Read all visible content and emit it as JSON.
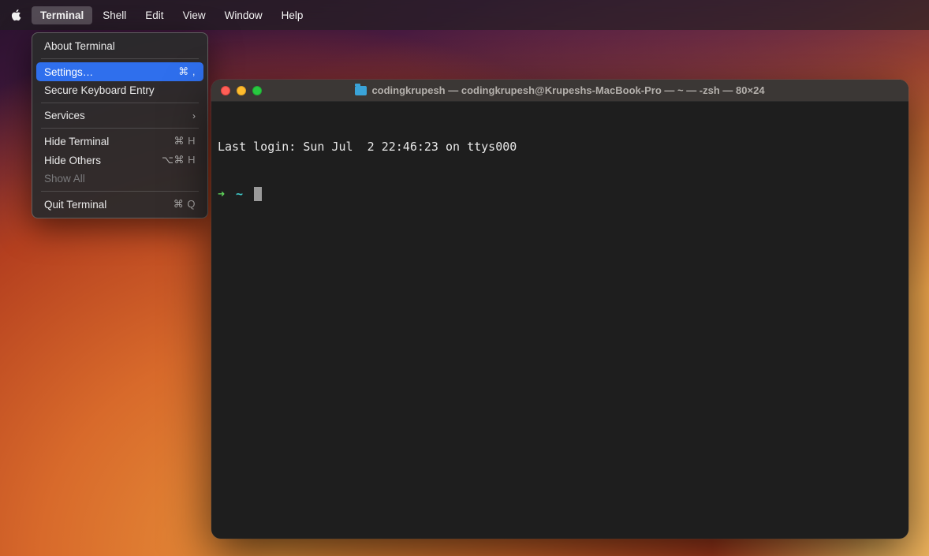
{
  "menubar": {
    "items": [
      "Terminal",
      "Shell",
      "Edit",
      "View",
      "Window",
      "Help"
    ],
    "active": "Terminal"
  },
  "dropdown": {
    "about": "About Terminal",
    "settings": {
      "label": "Settings…",
      "shortcut": "⌘ ,"
    },
    "secure": "Secure Keyboard Entry",
    "services": "Services",
    "hide": {
      "label": "Hide Terminal",
      "shortcut": "⌘ H"
    },
    "hide_others": {
      "label": "Hide Others",
      "shortcut": "⌥⌘ H"
    },
    "show_all": "Show All",
    "quit": {
      "label": "Quit Terminal",
      "shortcut": "⌘ Q"
    }
  },
  "terminal": {
    "title": "codingkrupesh — codingkrupesh@Krupeshs-MacBook-Pro — ~ — -zsh — 80×24",
    "last_login": "Last login: Sun Jul  2 22:46:23 on ttys000",
    "prompt_arrow": "➜",
    "prompt_cwd": "~"
  }
}
